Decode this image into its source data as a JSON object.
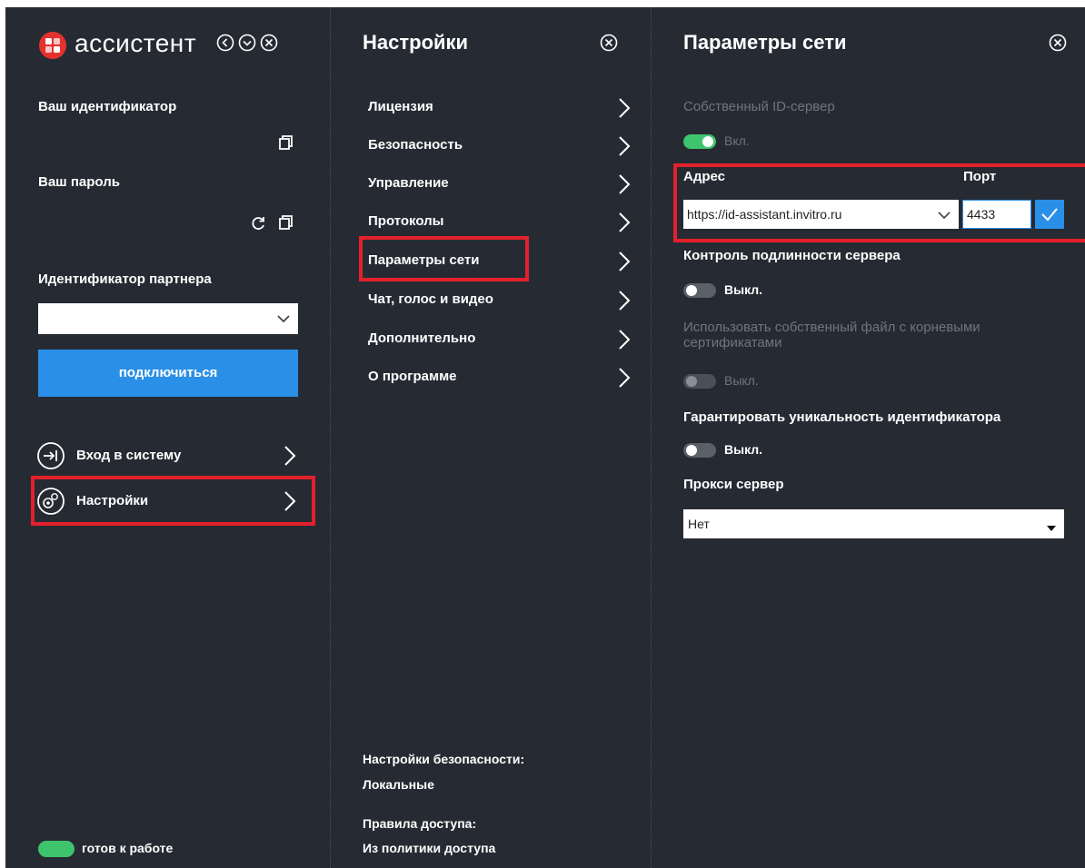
{
  "app": {
    "title": "ассистент",
    "your_id_label": "Ваш идентификатор",
    "your_password_label": "Ваш пароль",
    "partner_id_label": "Идентификатор партнера",
    "partner_id_value": "",
    "connect_button": "подключиться",
    "nav": [
      {
        "label": "Вход в систему",
        "icon": "login-icon"
      },
      {
        "label": "Настройки",
        "icon": "settings-gear-icon"
      }
    ],
    "status": "готов к работе"
  },
  "settings": {
    "title": "Настройки",
    "items": [
      {
        "label": "Лицензия"
      },
      {
        "label": "Безопасность"
      },
      {
        "label": "Управление"
      },
      {
        "label": "Протоколы"
      },
      {
        "label": "Параметры сети"
      },
      {
        "label": "Чат, голос и видео"
      },
      {
        "label": "Дополнительно"
      },
      {
        "label": "О программе"
      }
    ],
    "footer": {
      "security_label": "Настройки безопасности:",
      "security_value": "Локальные",
      "access_label": "Правила доступа:",
      "access_value": "Из политики доступа"
    }
  },
  "network": {
    "title": "Параметры сети",
    "own_id_server_label": "Собственный ID-сервер",
    "own_id_server_state": "Вкл.",
    "address_label": "Адрес",
    "port_label": "Порт",
    "address_value": "https://id-assistant.invitro.ru",
    "port_value": "4433",
    "server_auth_label": "Контроль подлинности сервера",
    "server_auth_state": "Выкл.",
    "own_cert_label": "Использовать собственный файл с корневыми сертификатами",
    "own_cert_state": "Выкл.",
    "unique_id_label": "Гарантировать уникальность идентификатора",
    "unique_id_state": "Выкл.",
    "proxy_label": "Прокси сервер",
    "proxy_value": "Нет"
  },
  "colors": {
    "background": "#262b33",
    "accent_blue": "#2a8fe6",
    "status_green": "#3ec46d",
    "highlight_red": "#e3202b",
    "logo_red": "#e5322d"
  }
}
